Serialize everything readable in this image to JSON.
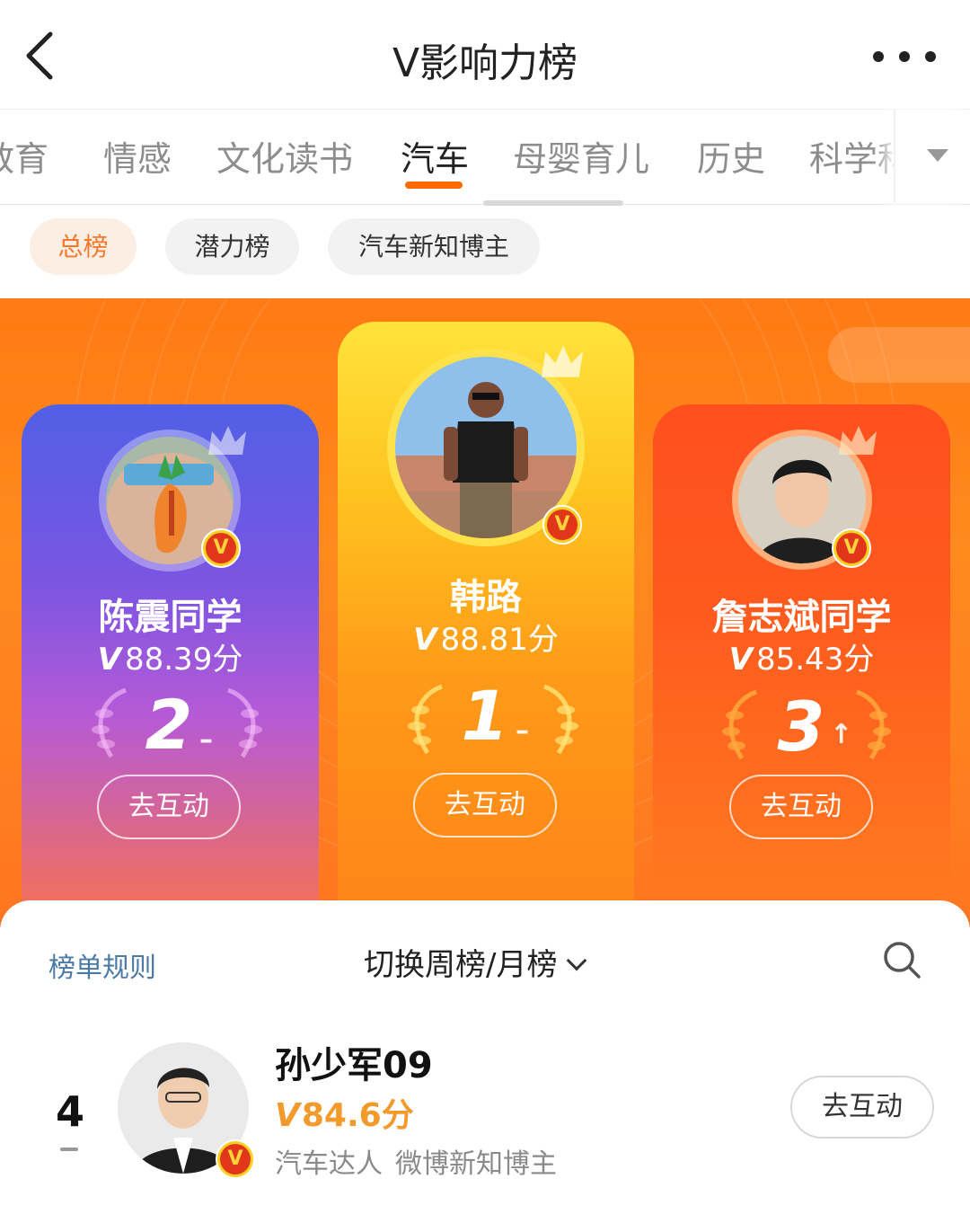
{
  "header": {
    "title": "V影响力榜"
  },
  "tabs": {
    "items": [
      "教育",
      "情感",
      "文化读书",
      "汽车",
      "母婴育儿",
      "历史",
      "科学科"
    ],
    "active_index": 3
  },
  "chips": {
    "items": [
      "总榜",
      "潜力榜",
      "汽车新知博主"
    ],
    "active_index": 0
  },
  "podium": [
    {
      "rank": "2",
      "name": "陈震同学",
      "score": "88.39分",
      "score_prefix": "V",
      "trend": "–",
      "action": "去互动"
    },
    {
      "rank": "1",
      "name": "韩路",
      "score": "88.81分",
      "score_prefix": "V",
      "trend": "–",
      "action": "去互动"
    },
    {
      "rank": "3",
      "name": "詹志斌同学",
      "score": "85.43分",
      "score_prefix": "V",
      "trend": "↑",
      "action": "去互动"
    }
  ],
  "toolbar": {
    "rules": "榜单规则",
    "switch": "切换周榜/月榜"
  },
  "list": [
    {
      "rank": "4",
      "name": "孙少军09",
      "score_prefix": "V",
      "score": "84.6分",
      "tags": [
        "汽车达人",
        "微博新知博主"
      ],
      "action": "去互动"
    }
  ],
  "colors": {
    "accent": "#ff6a00",
    "chip_active_text": "#f4792c",
    "score_orange": "#f39a2c",
    "link_blue": "#4c7aa8"
  }
}
